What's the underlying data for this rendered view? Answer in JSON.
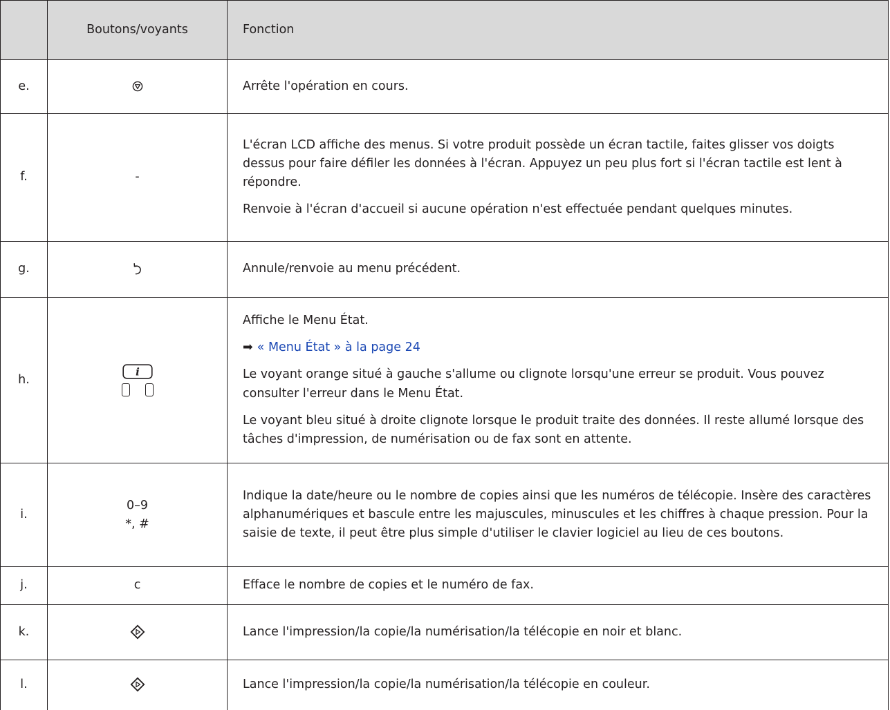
{
  "table": {
    "headers": {
      "letter": "",
      "button": "Boutons/voyants",
      "function": "Fonction"
    },
    "rows": [
      {
        "letter": "e.",
        "icon": "stop-icon",
        "function": [
          "Arrête l'opération en cours."
        ]
      },
      {
        "letter": "f.",
        "button_text": "-",
        "function": [
          "L'écran LCD affiche des menus. Si votre produit possède un écran tactile, faites glisser vos doigts dessus pour faire défiler les données à l'écran. Appuyez un peu plus fort si l'écran tactile est lent à répondre.",
          "Renvoie à l'écran d'accueil si aucune opération n'est effectuée pendant quelques minutes."
        ]
      },
      {
        "letter": "g.",
        "icon": "back-arrow-icon",
        "function": [
          "Annule/renvoie au menu précédent."
        ]
      },
      {
        "letter": "h.",
        "icon": "info-button-icon",
        "function_intro": "Affiche le Menu État.",
        "link": {
          "arrow": "➡",
          "text": "« Menu État » à la page 24"
        },
        "function": [
          "Le voyant orange situé à gauche s'allume ou clignote lorsqu'une erreur se produit. Vous pouvez consulter l'erreur dans le Menu État.",
          "Le voyant bleu situé à droite clignote lorsque le produit traite des données. Il reste allumé lorsque des tâches d'impression, de numérisation ou de fax sont en attente."
        ]
      },
      {
        "letter": "i.",
        "button_line1": "0–9",
        "button_line2": "*, #",
        "function": [
          "Indique la date/heure ou le nombre de copies ainsi que les numéros de télécopie. Insère des caractères alphanumériques et bascule entre les majuscules, minuscules et les chiffres à chaque pression. Pour la saisie de texte, il peut être plus simple d'utiliser le clavier logiciel au lieu de ces boutons."
        ]
      },
      {
        "letter": "j.",
        "button_text": "c",
        "function": [
          "Efface le nombre de copies et le numéro de fax."
        ]
      },
      {
        "letter": "k.",
        "icon": "start-icon",
        "function": [
          "Lance l'impression/la copie/la numérisation/la télécopie en noir et blanc."
        ]
      },
      {
        "letter": "l.",
        "icon": "start-icon",
        "function": [
          "Lance l'impression/la copie/la numérisation/la télécopie en couleur."
        ]
      }
    ]
  }
}
